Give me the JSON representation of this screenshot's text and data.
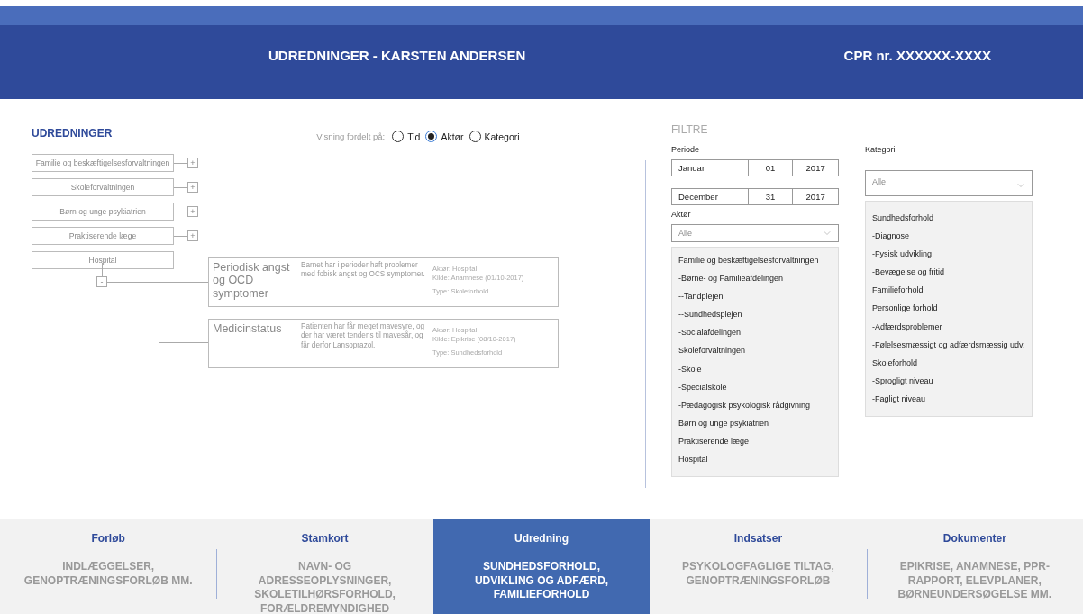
{
  "header": {
    "title": "UDREDNINGER - KARSTEN ANDERSEN",
    "cpr": "CPR nr. XXXXXX-XXXX"
  },
  "udredninger": {
    "heading": "UDREDNINGER",
    "view": {
      "label": "Visning fordelt på:",
      "options": [
        {
          "label": "Tid",
          "selected": false
        },
        {
          "label": "Aktør",
          "selected": true
        },
        {
          "label": "Kategori",
          "selected": false
        }
      ]
    },
    "tree": [
      {
        "label": "Familie og beskæftigelsesforvaltningen",
        "toggle": "+",
        "expanded": false
      },
      {
        "label": "Skoleforvaltningen",
        "toggle": "+",
        "expanded": false
      },
      {
        "label": "Børn og unge psykiatrien",
        "toggle": "+",
        "expanded": false
      },
      {
        "label": "Praktiserende læge",
        "toggle": "+",
        "expanded": false
      },
      {
        "label": "Hospital",
        "toggle": "-",
        "expanded": true,
        "children": [
          {
            "title": "Periodisk angst og OCD symptomer",
            "description": "Barnet har i perioder haft problemer med fobisk angst og OCS symptomer.",
            "meta": [
              "Aktør: Hospital",
              "Kilde: Anamnese (01/10-2017)",
              "Type: Skoleforhold"
            ]
          },
          {
            "title": "Medicinstatus",
            "description": "Patienten har får meget mavesyre, og der har været tendens til mavesår, og får derfor Lansoprazol.",
            "meta": [
              "Aktør: Hospital",
              "Kilde: Epikrise (08/10-2017)",
              "Type: Sundhedsforhold"
            ]
          }
        ]
      }
    ]
  },
  "filters": {
    "heading": "FILTRE",
    "periode": {
      "label": "Periode",
      "from": [
        "Januar",
        "01",
        "2017"
      ],
      "to": [
        "December",
        "31",
        "2017"
      ]
    },
    "aktor": {
      "label": "Aktør",
      "value": "Alle",
      "options": [
        "Familie og beskæftigelsesforvaltningen",
        "-Børne- og Familieafdelingen",
        "--Tandplejen",
        "--Sundhedsplejen",
        "-Socialafdelingen",
        "Skoleforvaltningen",
        "-Skole",
        "-Specialskole",
        "-Pædagogisk psykologisk rådgivning",
        "Børn og unge psykiatrien",
        "Praktiserende læge",
        "Hospital"
      ]
    },
    "kategori": {
      "label": "Kategori",
      "value": "Alle",
      "options": [
        "Sundhedsforhold",
        "-Diagnose",
        "-Fysisk udvikling",
        "-Bevægelse og fritid",
        "Familieforhold",
        "Personlige forhold",
        "-Adfærdsproblemer",
        "-Følelsesmæssigt og adfærdsmæssig udv.",
        "Skoleforhold",
        "-Sprogligt niveau",
        "-Fagligt niveau"
      ]
    }
  },
  "nav": [
    {
      "title": "Forløb",
      "description": "INDLÆGGELSER, GENOPTRÆNINGSFORLØB MM.",
      "selected": false
    },
    {
      "title": "Stamkort",
      "description": "NAVN- OG ADRESSEOPLYSNINGER, SKOLETILHØRSFORHOLD, FORÆLDREMYNDIGHED",
      "selected": false
    },
    {
      "title": "Udredning",
      "description": "SUNDHEDSFORHOLD, UDVIKLING OG ADFÆRD, FAMILIEFORHOLD",
      "selected": true
    },
    {
      "title": "Indsatser",
      "description": "PSYKOLOGFAGLIGE TILTAG, GENOPTRÆNINGSFORLØB",
      "selected": false
    },
    {
      "title": "Dokumenter",
      "description": "EPIKRISE, ANAMNESE, PPR-RAPPORT, ELEVPLANER, BØRNEUNDERSØGELSE MM.",
      "selected": false
    }
  ]
}
